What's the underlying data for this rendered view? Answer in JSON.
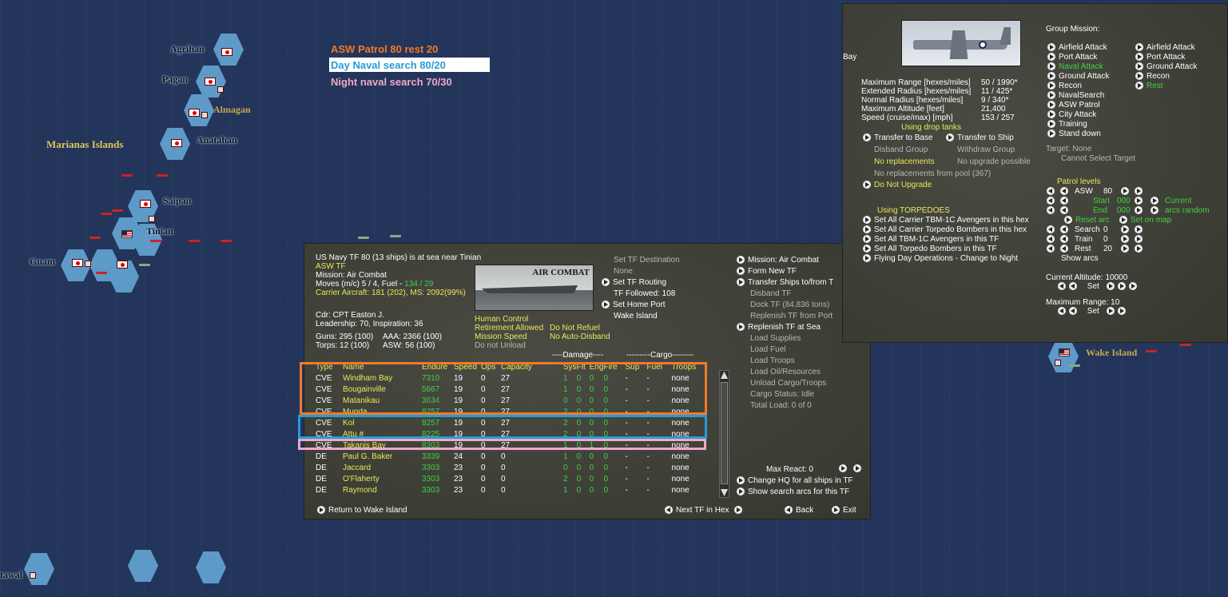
{
  "map": {
    "labels": {
      "agrihan": "Agrihan",
      "pagan": "Pagan",
      "almagan": "Almagan",
      "anatahan": "Anatahan",
      "marianas": "Marianas Islands",
      "saipan": "Saipan",
      "tinian": "Tinian",
      "guam": "Guam",
      "wake": "Wake Island",
      "tawal": "tawal"
    }
  },
  "legend": {
    "asw": "ASW Patrol 80 rest 20",
    "day": "Day Naval search 80/20",
    "night": "Night naval search 70/30"
  },
  "colors": {
    "asw": "#f07a2a",
    "day": "#2a9ad8",
    "night": "#f0a8c8",
    "yellow": "#e8e85a",
    "green": "#3fd13f"
  },
  "tf": {
    "header": "US Navy TF 80 (13 ships) is at sea near Tinian",
    "type": "ASW TF",
    "mission": "Mission: Air Combat",
    "moves": "Moves (m/c) 5 / 4, Fuel - ",
    "fuel": "134 / 29",
    "carrier_aircraft": "Carrier Aircraft: 181 (202), MS: 2092(99%)",
    "cdr": "Cdr: CPT  Easton J.",
    "leadership": "Leadership: 70, Inspiration: 36",
    "guns": "Guns: 295 (100)",
    "aaa": "AAA: 2366 (100)",
    "torps": "Torps: 12 (100)",
    "asw": "ASW: 56 (100)",
    "image_caption": "AIR COMBAT",
    "control": {
      "human": "Human Control",
      "retire": "Retirement Allowed",
      "refuel": "Do Not Refuel",
      "speed": "Mission Speed",
      "disband": "No Auto-Disband",
      "unload": "Do not Unload"
    },
    "mid": {
      "set_dest": "Set TF Destination",
      "none": "None",
      "routing": "Set TF Routing",
      "followed": "TF Followed: 108",
      "home": "Set Home Port",
      "wake": "Wake Island"
    },
    "right": {
      "mission": "Mission: Air Combat",
      "form": "Form New TF",
      "transfer": "Transfer Ships to/from T",
      "disband": "Disband TF",
      "dock": "Dock TF (84,836 tons)",
      "replenish_port": "Replenish TF from Port",
      "replenish_sea": "Replenish TF at Sea",
      "load_supplies": "Load Supplies",
      "load_fuel": "Load Fuel",
      "load_troops": "Load Troops",
      "load_oil": "Load Oil/Resources",
      "unload": "Unload Cargo/Troops",
      "cargo": "Cargo Status: Idle",
      "total": "Total Load: 0 of 0",
      "max_react": "Max React:  0",
      "change_hq": "Change HQ for all ships in TF",
      "show_arcs": "Show search arcs for this TF"
    },
    "bottom": {
      "return": "Return to Wake Island",
      "next": "Next TF in Hex",
      "back": "Back",
      "exit": "Exit"
    },
    "group_headers": {
      "damage": "----Damage----",
      "cargo": "---------Cargo--------"
    },
    "columns": [
      "Type",
      "Name",
      "Endure",
      "Speed",
      "Ops",
      "Capacity",
      "Sys",
      "Flt",
      "Eng",
      "Fire",
      "Sup",
      "Fuel",
      "Troops"
    ],
    "ships": [
      [
        "CVE",
        "Windham Bay",
        "7310",
        "19",
        "0",
        "27",
        "1",
        "0",
        "0",
        "0",
        "-",
        "-",
        "none"
      ],
      [
        "CVE",
        "Bougainville",
        "5667",
        "19",
        "0",
        "27",
        "1",
        "0",
        "0",
        "0",
        "-",
        "-",
        "none"
      ],
      [
        "CVE",
        "Matanikau",
        "3634",
        "19",
        "0",
        "27",
        "0",
        "0",
        "0",
        "0",
        "-",
        "-",
        "none"
      ],
      [
        "CVE",
        "Munda",
        "8257",
        "19",
        "0",
        "27",
        "2",
        "0",
        "0",
        "0",
        "-",
        "-",
        "none"
      ],
      [
        "CVE",
        "Kol",
        "8257",
        "19",
        "0",
        "27",
        "2",
        "0",
        "0",
        "0",
        "-",
        "-",
        "none"
      ],
      [
        "CVE",
        "Attu #",
        "8225",
        "19",
        "0",
        "27",
        "2",
        "0",
        "0",
        "0",
        "-",
        "-",
        "none"
      ],
      [
        "CVE",
        "Takanis Bay",
        "8303",
        "19",
        "0",
        "27",
        "1",
        "0",
        "1",
        "0",
        "-",
        "-",
        "none"
      ],
      [
        "DE",
        "Paul G. Baker",
        "3339",
        "24",
        "0",
        "0",
        "1",
        "0",
        "0",
        "0",
        "-",
        "-",
        "none"
      ],
      [
        "DE",
        "Jaccard",
        "3303",
        "23",
        "0",
        "0",
        "0",
        "0",
        "0",
        "0",
        "-",
        "-",
        "none"
      ],
      [
        "DE",
        "O'Flaherty",
        "3303",
        "23",
        "0",
        "0",
        "2",
        "0",
        "0",
        "0",
        "-",
        "-",
        "none"
      ],
      [
        "DE",
        "Raymond",
        "3303",
        "23",
        "0",
        "0",
        "1",
        "0",
        "0",
        "0",
        "-",
        "-",
        "none"
      ]
    ]
  },
  "air": {
    "bay": "Bay",
    "stats": [
      [
        "Maximum Range [hexes/miles]",
        "50 / 1990*"
      ],
      [
        "Extended Radius [hexes/miles]",
        "11 / 425*"
      ],
      [
        "Normal Radius [hexes/miles]",
        "9 / 340*"
      ],
      [
        "Maximum Altitude [feet]",
        "21,400"
      ],
      [
        "Speed (cruise/max) [mph]",
        "153 / 257"
      ]
    ],
    "drop_tanks": "Using drop tanks",
    "transfer_base": "Transfer to Base",
    "transfer_ship": "Transfer to Ship",
    "disband": "Disband Group",
    "withdraw": "Withdraw Group",
    "no_repl": "No replacements",
    "no_upgrade": "No upgrade possible",
    "no_pool": "No replacements from pool (367)",
    "do_not_upgrade": "Do Not Upgrade",
    "torpedoes": "Using TORPEDOES",
    "set_lines": [
      "Set All Carrier TBM-1C Avengers in this hex",
      "Set All Carrier Torpedo Bombers in this hex",
      "Set All TBM-1C Avengers in this TF",
      "Set All Torpedo Bombers in this TF",
      "Flying Day Operations - Change to Night"
    ],
    "group_mission": "Group Mission:",
    "missions_left": [
      "Airfield Attack",
      "Port Attack",
      "Naval Attack",
      "Ground Attack",
      "Recon",
      "NavalSearch",
      "ASW Patrol",
      "City Attack",
      "Training",
      "Stand down"
    ],
    "missions_right": [
      "Airfield Attack",
      "Port Attack",
      "Ground Attack",
      "Recon",
      "Rest"
    ],
    "target": "Target: None",
    "cannot_select": "Cannot Select Target",
    "patrol_levels": "Patrol levels",
    "asw_label": "ASW",
    "asw_val": "80",
    "start": "Start",
    "start_val": "000",
    "end": "End",
    "end_val": "000",
    "current": "Current",
    "arcs_random": "arcs random",
    "reset_arc": "Reset arc",
    "set_on_map": "Set on map",
    "search": "Search",
    "search_val": "0",
    "train": "Train",
    "train_val": "0",
    "rest": "Rest",
    "rest_val": "20",
    "show_arcs": "Show arcs",
    "cur_alt": "Current Altitude: 10000",
    "set": "Set",
    "max_range": "Maximum Range: 10"
  }
}
